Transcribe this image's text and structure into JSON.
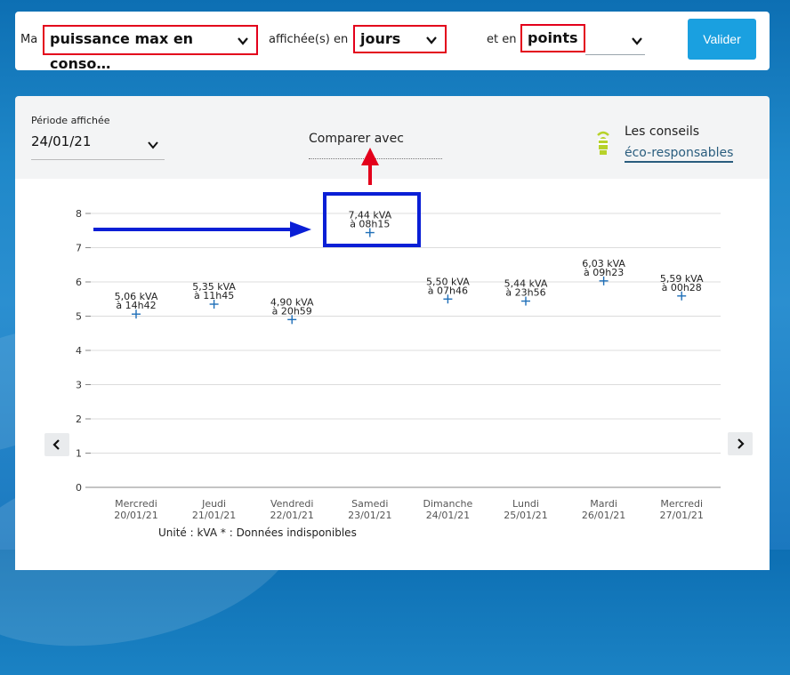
{
  "filters": {
    "prefix": "Ma",
    "metric_value": "puissance max en conso…",
    "displayed_in_label": "affichée(s) en",
    "period_unit_value": "jours",
    "and_in_label": "et en",
    "display_mode_value": "points",
    "submit_label": "Valider"
  },
  "period": {
    "label": "Période affichée",
    "value": "24/01/21"
  },
  "compare": {
    "label": "Comparer avec"
  },
  "tips": {
    "line1": "Les conseils",
    "line2": "éco-responsables"
  },
  "chart_data": {
    "type": "scatter",
    "categories": [
      [
        "Mercredi",
        "20/01/21"
      ],
      [
        "Jeudi",
        "21/01/21"
      ],
      [
        "Vendredi",
        "22/01/21"
      ],
      [
        "Samedi",
        "23/01/21"
      ],
      [
        "Dimanche",
        "24/01/21"
      ],
      [
        "Lundi",
        "25/01/21"
      ],
      [
        "Mardi",
        "26/01/21"
      ],
      [
        "Mercredi",
        "27/01/21"
      ]
    ],
    "values": [
      5.06,
      5.35,
      4.9,
      7.44,
      5.5,
      5.44,
      6.03,
      5.59
    ],
    "labels": [
      [
        "5,06 kVA",
        "à 14h42"
      ],
      [
        "5,35 kVA",
        "à 11h45"
      ],
      [
        "4,90 kVA",
        "à 20h59"
      ],
      [
        "7,44 kVA",
        "à 08h15"
      ],
      [
        "5,50 kVA",
        "à 07h46"
      ],
      [
        "5,44 kVA",
        "à 23h56"
      ],
      [
        "6,03 kVA",
        "à 09h23"
      ],
      [
        "5,59 kVA",
        "à 00h28"
      ]
    ],
    "ylim": [
      0,
      8
    ],
    "yticks": [
      0,
      1,
      2,
      3,
      4,
      5,
      6,
      7,
      8
    ],
    "grid": true,
    "marker": "+",
    "marker_color": "#1f6fb8",
    "footnote": "Unité : kVA   * : Données indisponibles"
  },
  "annotations": {
    "highlight_color": "#0a1fd6",
    "arrow_up_color": "#e3001b",
    "outline_color": "#e3001b"
  }
}
